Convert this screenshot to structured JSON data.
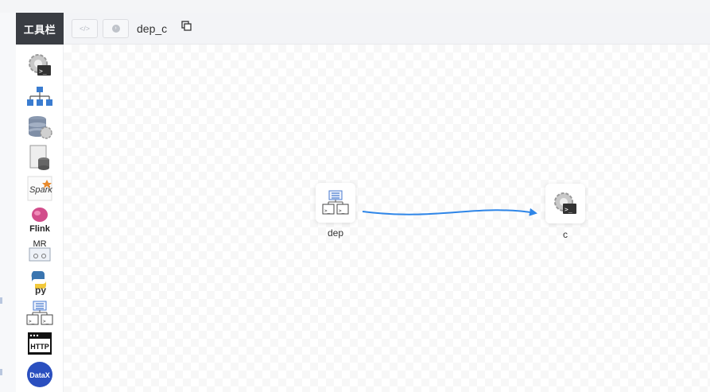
{
  "toolbar": {
    "title": "工具栏"
  },
  "header": {
    "flow_name": "dep_c",
    "back_icon": "code-icon",
    "next_icon": "circle-arrow-icon"
  },
  "tools": [
    {
      "name": "shell",
      "icon": "gear-terminal-icon"
    },
    {
      "name": "sub-process",
      "icon": "hierarchy-icon"
    },
    {
      "name": "procedure",
      "icon": "database-gear-icon"
    },
    {
      "name": "sql",
      "icon": "document-database-icon"
    },
    {
      "name": "spark",
      "icon": "spark-icon",
      "text": "Spark"
    },
    {
      "name": "flink",
      "icon": "flink-icon",
      "text": "Flink"
    },
    {
      "name": "mr",
      "icon": "mapreduce-icon",
      "text": "MR"
    },
    {
      "name": "python",
      "icon": "python-icon",
      "text": "py"
    },
    {
      "name": "dependent",
      "icon": "dependent-icon"
    },
    {
      "name": "http",
      "icon": "http-icon",
      "text": "HTTP"
    },
    {
      "name": "datax",
      "icon": "datax-icon",
      "text": "DataX"
    }
  ],
  "nodes": [
    {
      "label": "dep",
      "icon": "dependent-icon"
    },
    {
      "label": "c",
      "icon": "gear-terminal-icon"
    }
  ],
  "colors": {
    "toolbar_head": "#3a3d43",
    "edge": "#2f86e8",
    "datax": "#2a4fbf"
  }
}
